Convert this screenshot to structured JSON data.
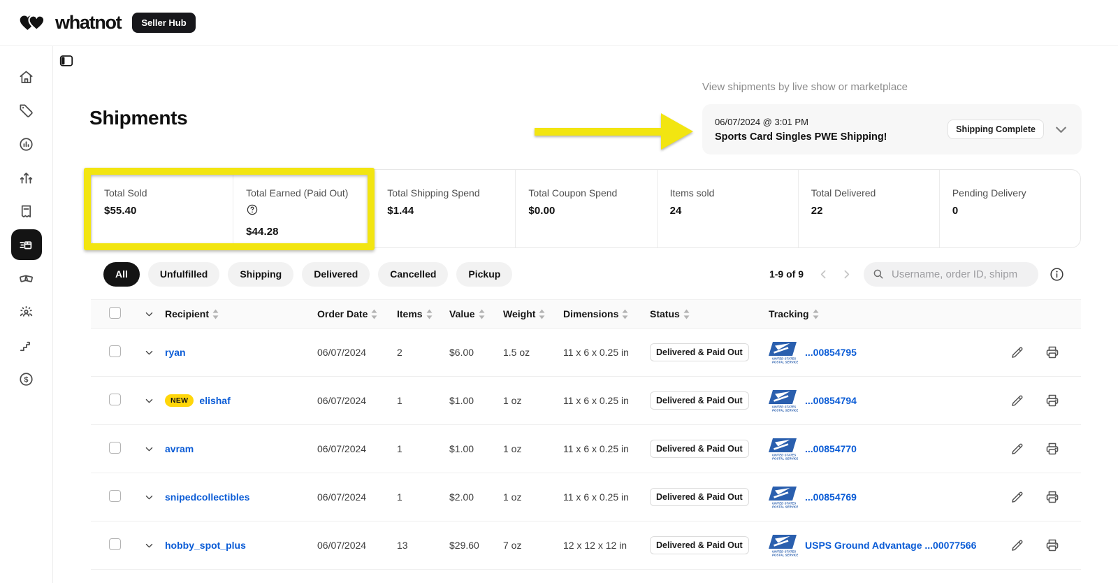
{
  "topbar": {
    "brand": "whatnot",
    "badge": "Seller Hub"
  },
  "sidebar": {
    "items": [
      {
        "id": "home",
        "icon": "home-icon"
      },
      {
        "id": "tag",
        "icon": "tag-icon"
      },
      {
        "id": "analytics",
        "icon": "analytics-icon"
      },
      {
        "id": "growth",
        "icon": "growth-icon"
      },
      {
        "id": "orders",
        "icon": "orders-icon"
      },
      {
        "id": "shipments",
        "icon": "shipments-icon",
        "active": true
      },
      {
        "id": "breaks",
        "icon": "breaks-icon"
      },
      {
        "id": "community",
        "icon": "community-icon"
      },
      {
        "id": "levels",
        "icon": "levels-icon"
      },
      {
        "id": "earnings",
        "icon": "earnings-icon"
      }
    ]
  },
  "page": {
    "title": "Shipments"
  },
  "show_selector": {
    "label": "View shipments by live show or marketplace",
    "date": "06/07/2024 @ 3:01 PM",
    "show_title": "Sports Card Singles PWE Shipping!",
    "status_badge": "Shipping Complete"
  },
  "stats": {
    "cards": [
      {
        "label": "Total Sold",
        "value": "$55.40"
      },
      {
        "label": "Total Earned (Paid Out)",
        "value": "$44.28",
        "help": true
      },
      {
        "label": "Total Shipping Spend",
        "value": "$1.44"
      },
      {
        "label": "Total Coupon Spend",
        "value": "$0.00"
      },
      {
        "label": "Items sold",
        "value": "24"
      },
      {
        "label": "Total Delivered",
        "value": "22"
      },
      {
        "label": "Pending Delivery",
        "value": "0"
      }
    ]
  },
  "filters": {
    "tabs": [
      {
        "label": "All",
        "active": true
      },
      {
        "label": "Unfulfilled"
      },
      {
        "label": "Shipping"
      },
      {
        "label": "Delivered"
      },
      {
        "label": "Cancelled"
      },
      {
        "label": "Pickup"
      }
    ]
  },
  "pagination": {
    "range": "1-9 of 9"
  },
  "search": {
    "placeholder": "Username, order ID, shipm"
  },
  "table": {
    "columns": [
      "Recipient",
      "Order Date",
      "Items",
      "Value",
      "Weight",
      "Dimensions",
      "Status",
      "Tracking"
    ],
    "rows": [
      {
        "recipient": "ryan",
        "order_date": "06/07/2024",
        "items": "2",
        "value": "$6.00",
        "weight": "1.5 oz",
        "dimensions": "11 x 6 x 0.25 in",
        "status": "Delivered & Paid Out",
        "carrier": "usps-logo",
        "tracking": "...00854795"
      },
      {
        "recipient": "elishaf",
        "new_label": "NEW",
        "order_date": "06/07/2024",
        "items": "1",
        "value": "$1.00",
        "weight": "1 oz",
        "dimensions": "11 x 6 x 0.25 in",
        "status": "Delivered & Paid Out",
        "carrier": "usps-logo",
        "tracking": "...00854794"
      },
      {
        "recipient": "avram",
        "order_date": "06/07/2024",
        "items": "1",
        "value": "$1.00",
        "weight": "1 oz",
        "dimensions": "11 x 6 x 0.25 in",
        "status": "Delivered & Paid Out",
        "carrier": "usps-logo",
        "tracking": "...00854770"
      },
      {
        "recipient": "snipedcollectibles",
        "order_date": "06/07/2024",
        "items": "1",
        "value": "$2.00",
        "weight": "1 oz",
        "dimensions": "11 x 6 x 0.25 in",
        "status": "Delivered & Paid Out",
        "carrier": "usps-logo",
        "tracking": "...00854769"
      },
      {
        "recipient": "hobby_spot_plus",
        "order_date": "06/07/2024",
        "items": "13",
        "value": "$29.60",
        "weight": "7 oz",
        "dimensions": "12 x 12 x 12 in",
        "status": "Delivered & Paid Out",
        "carrier": "usps-logo",
        "tracking": "USPS Ground Advantage ...00077566"
      }
    ]
  },
  "annotations": {
    "highlight_color": "#F2E511"
  },
  "colors": {
    "link_blue": "#0b5cd6",
    "new_badge_yellow": "#FFD60A",
    "usps_blue": "#2a5fae",
    "active_nav_bg": "#141414"
  }
}
